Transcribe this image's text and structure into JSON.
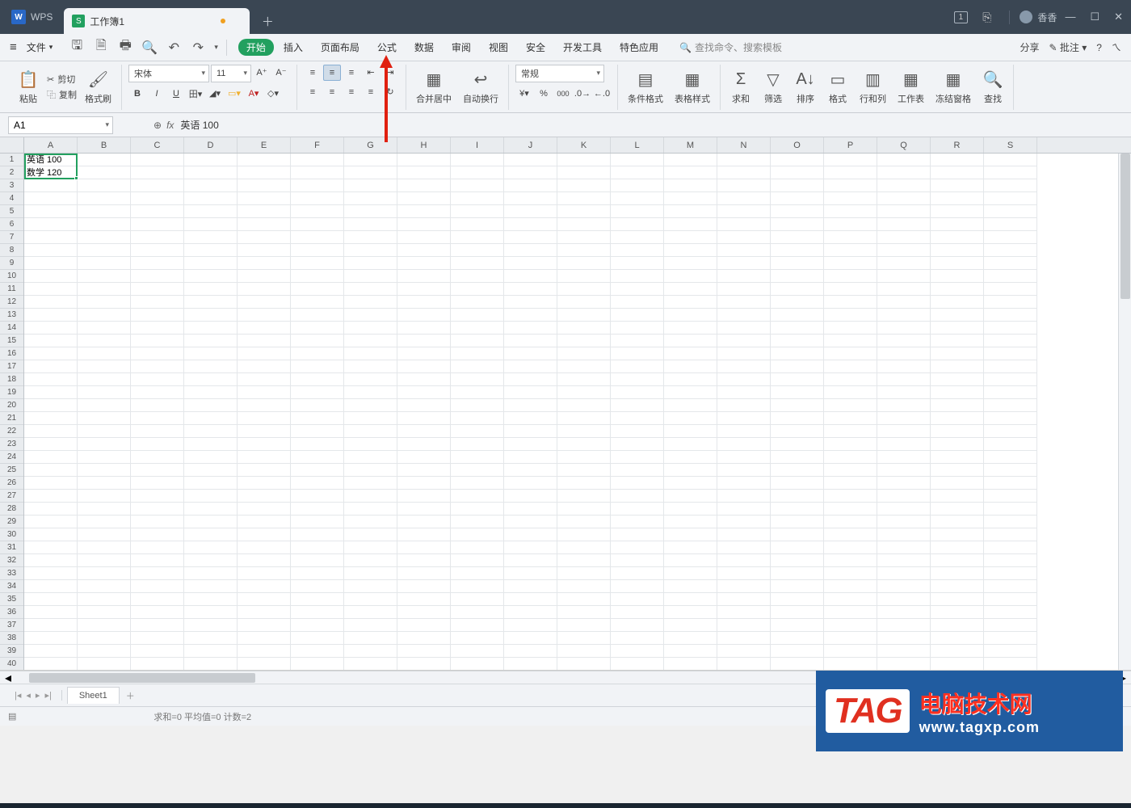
{
  "titlebar": {
    "app": "WPS",
    "doc_tab": "工作簿1",
    "user": "香香"
  },
  "menu": {
    "file": "文件",
    "tabs": [
      "开始",
      "插入",
      "页面布局",
      "公式",
      "数据",
      "审阅",
      "视图",
      "安全",
      "开发工具",
      "特色应用"
    ],
    "search_hint": "查找命令、搜索模板",
    "share": "分享",
    "comment": "批注",
    "font_name": "宋体",
    "font_size": "11"
  },
  "ribbon": {
    "paste": "粘贴",
    "cut": "剪切",
    "copy": "复制",
    "format_painter": "格式刷",
    "merge_center": "合并居中",
    "wrap": "自动换行",
    "number_format": "常规",
    "cond_format": "条件格式",
    "table_style": "表格样式",
    "sum": "求和",
    "filter": "筛选",
    "sort": "排序",
    "format": "格式",
    "row_col": "行和列",
    "worksheet": "工作表",
    "freeze": "冻结窗格",
    "find": "查找"
  },
  "namebox": {
    "ref": "A1",
    "formula": "英语 100"
  },
  "columns": [
    "A",
    "B",
    "C",
    "D",
    "E",
    "F",
    "G",
    "H",
    "I",
    "J",
    "K",
    "L",
    "M",
    "N",
    "O",
    "P",
    "Q",
    "R",
    "S"
  ],
  "rows": 41,
  "cells": {
    "A1": "英语 100",
    "A2": "数学 120"
  },
  "sheet": {
    "name": "Sheet1"
  },
  "status": {
    "summary": "求和=0  平均值=0  计数=2"
  },
  "watermark": {
    "tag": "TAG",
    "cn": "电脑技术网",
    "url": "www.tagxp.com"
  }
}
